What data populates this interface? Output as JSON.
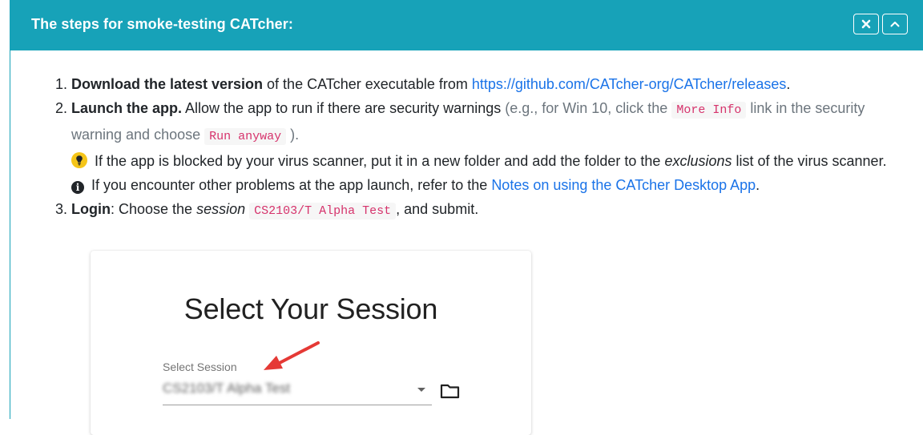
{
  "header": {
    "title": "The steps for smoke-testing CATcher:",
    "close_icon": "close-icon",
    "collapse_icon": "chevron-up-icon",
    "color": "#17a2b8"
  },
  "steps": {
    "step1": {
      "bold": "Download the latest version",
      "text": " of the CATcher executable from ",
      "link": "https://github.com/CATcher-org/CATcher/releases",
      "end": "."
    },
    "step2": {
      "bold": "Launch the app.",
      "text": " Allow the app to run if there are security warnings ",
      "muted1": "(e.g., for Win 10, click the ",
      "code1": "More Info",
      "muted2": " link in the security warning and choose ",
      "code2": "Run anyway",
      "muted3": " ).",
      "tip_icon": "lightbulb-icon",
      "tip_pre": " If the app is blocked by your virus scanner, put it in a new folder and add the folder to the ",
      "tip_em": "exclusions",
      "tip_post": " list of the virus scanner.",
      "info_icon": "info-icon",
      "info_pre": " If you encounter other problems at the app launch, refer to the ",
      "info_link": "Notes on using the CATcher Desktop App",
      "info_end": "."
    },
    "step3": {
      "bold": "Login",
      "text1": ": Choose the ",
      "em": "session",
      "code": "CS2103/T Alpha Test",
      "text2": ", and submit."
    }
  },
  "screenshot": {
    "title": "Select Your Session",
    "select_label": "Select Session",
    "select_value": "CS2103/T Alpha Test",
    "folder_icon": "folder-icon",
    "arrow_icon": "red-arrow-icon"
  }
}
